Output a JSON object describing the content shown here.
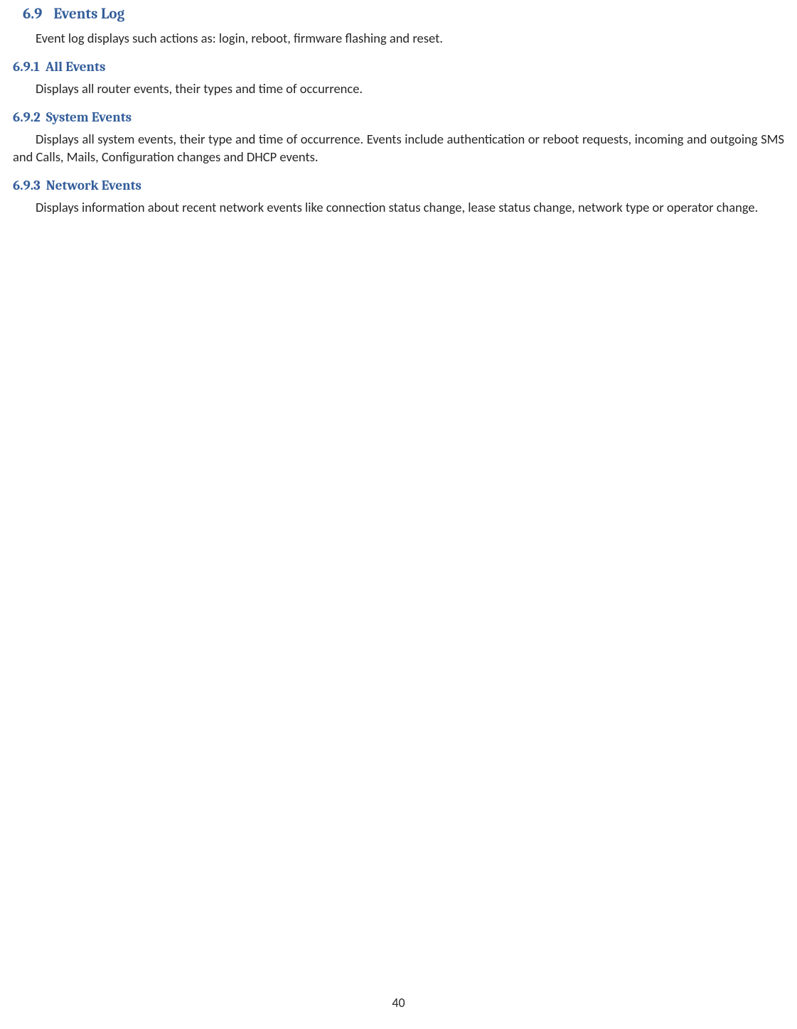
{
  "section": {
    "number": "6.9",
    "title": "Events Log",
    "intro": "Event log displays such actions as: login, reboot, firmware flashing and reset."
  },
  "subsections": [
    {
      "number": "6.9.1",
      "title": "All Events",
      "body": "Displays all router events, their types and time of occurrence."
    },
    {
      "number": "6.9.2",
      "title": "System Events",
      "body": "Displays all system events, their type and time of occurrence. Events include authentication or reboot requests, incoming and outgoing SMS and Calls, Mails, Configuration changes and DHCP events."
    },
    {
      "number": "6.9.3",
      "title": "Network Events",
      "body": "Displays information about recent network events like connection status change, lease status change, network type or operator change."
    }
  ],
  "page_number": "40"
}
